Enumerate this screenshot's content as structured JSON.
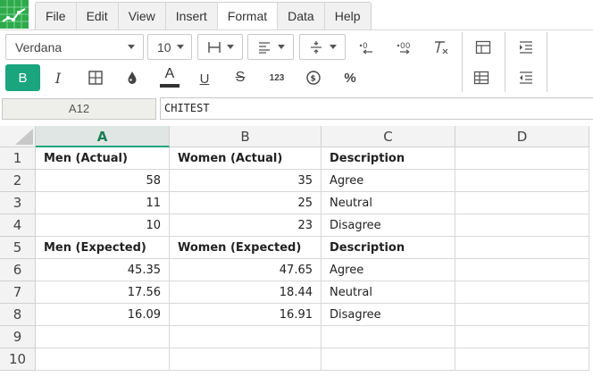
{
  "menu": {
    "items": [
      "File",
      "Edit",
      "View",
      "Insert",
      "Format",
      "Data",
      "Help"
    ],
    "active_index": 4
  },
  "toolbar": {
    "font_family": "Verdana",
    "font_size": "10",
    "bold_label": "B",
    "italic_label": "I",
    "text_color_label": "A",
    "underline_label": "U",
    "strike_label": "S",
    "number_format_label": "123",
    "percent_label": "%",
    "accent_color": "#1aa57e"
  },
  "formula_bar": {
    "cell_ref": "A12",
    "formula": "CHITEST"
  },
  "sheet": {
    "columns": [
      "A",
      "B",
      "C",
      "D"
    ],
    "selected_column": "A",
    "row_numbers": [
      "1",
      "2",
      "3",
      "4",
      "5",
      "6",
      "7",
      "8",
      "9",
      "10"
    ],
    "rows": [
      [
        "Men (Actual)",
        "Women (Actual)",
        "Description",
        ""
      ],
      [
        "58",
        "35",
        "Agree",
        ""
      ],
      [
        "11",
        "25",
        "Neutral",
        ""
      ],
      [
        "10",
        "23",
        "Disagree",
        ""
      ],
      [
        "Men (Expected)",
        "Women (Expected)",
        "Description",
        ""
      ],
      [
        "45.35",
        "47.65",
        "Agree",
        ""
      ],
      [
        "17.56",
        "18.44",
        "Neutral",
        ""
      ],
      [
        "16.09",
        "16.91",
        "Disagree",
        ""
      ],
      [
        "",
        "",
        "",
        ""
      ],
      [
        "",
        "",
        "",
        ""
      ]
    ]
  }
}
